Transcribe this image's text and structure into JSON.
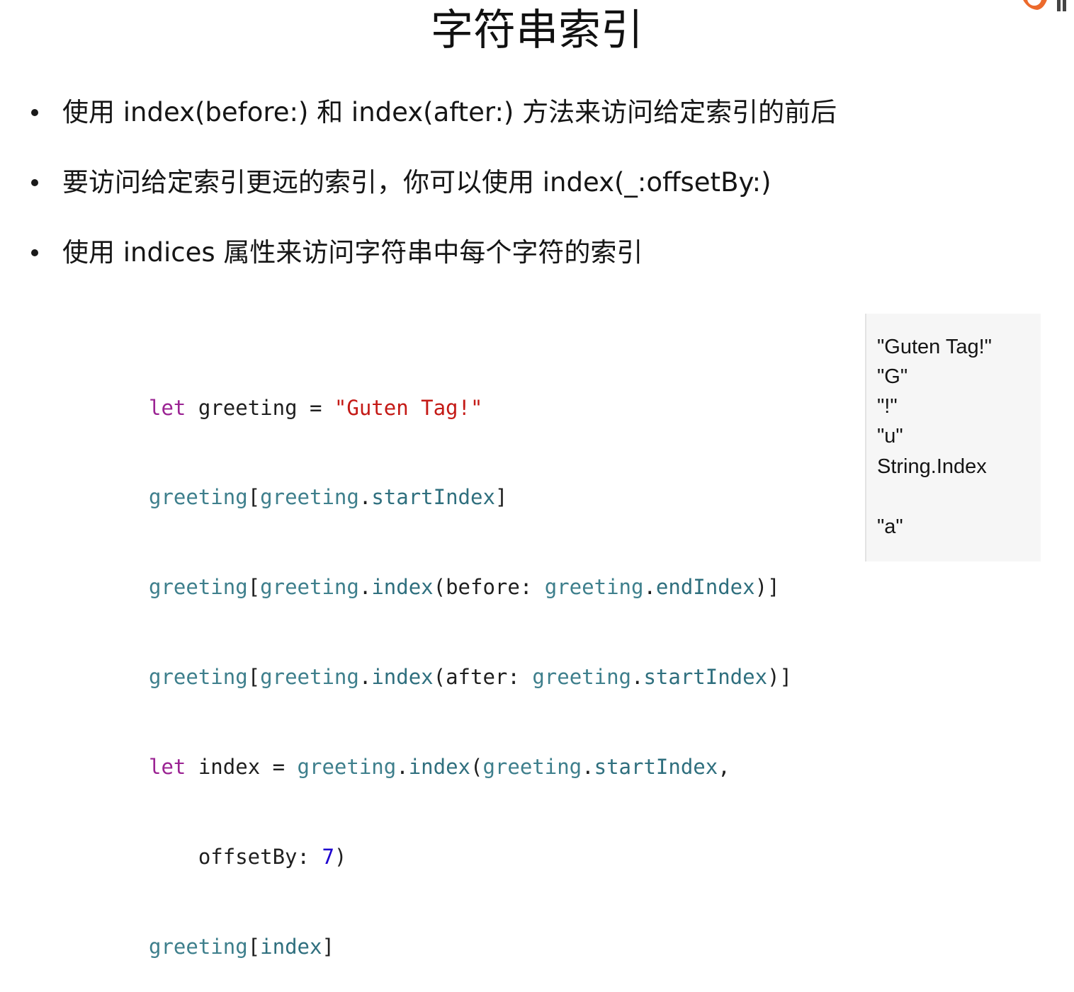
{
  "slide": {
    "title": "字符串索引"
  },
  "bullets": [
    "使用 index(before:) 和 index(after:) 方法来访问给定索引的前后",
    "要访问给定索引更远的索引，你可以使用 index(_:offsetBy:)",
    "使用 indices 属性来访问字符串中每个字符的索引"
  ],
  "code": {
    "line1": {
      "kw": "let",
      "pl1": " greeting = ",
      "str": "\"Guten Tag!\""
    },
    "line2": {
      "id1": "greeting",
      "pl1": "[",
      "id2": "greeting",
      "pl2": ".",
      "mb1": "startIndex",
      "pl3": "]"
    },
    "line3": {
      "id1": "greeting",
      "pl1": "[",
      "id2": "greeting",
      "pl2": ".",
      "mb1": "index",
      "pl3": "(before: ",
      "id3": "greeting",
      "pl4": ".",
      "mb2": "endIndex",
      "pl5": ")]"
    },
    "line4": {
      "id1": "greeting",
      "pl1": "[",
      "id2": "greeting",
      "pl2": ".",
      "mb1": "index",
      "pl3": "(after: ",
      "id3": "greeting",
      "pl4": ".",
      "mb2": "startIndex",
      "pl5": ")]"
    },
    "line5": {
      "kw": "let",
      "pl1": " index = ",
      "id1": "greeting",
      "pl2": ".",
      "mb1": "index",
      "pl3": "(",
      "id2": "greeting",
      "pl4": ".",
      "mb2": "startIndex",
      "pl5": ","
    },
    "line6": {
      "pl1": "    offsetBy: ",
      "num": "7",
      "pl2": ")"
    },
    "line7": {
      "id1": "greeting",
      "pl1": "[",
      "id2": "index",
      "pl2": "]"
    }
  },
  "results": [
    "\"Guten Tag!\"",
    "\"G\"",
    "\"!\"",
    "\"u\"",
    "String.Index",
    "\"a\""
  ],
  "colors": {
    "keyword": "#9b2393",
    "identifier": "#3e7f8c",
    "member": "#2f6f7e",
    "string": "#c41a16",
    "number": "#1c00cf",
    "logo_orange": "#ec6a2c"
  },
  "icons": {
    "logo": "brand-logo-icon"
  }
}
